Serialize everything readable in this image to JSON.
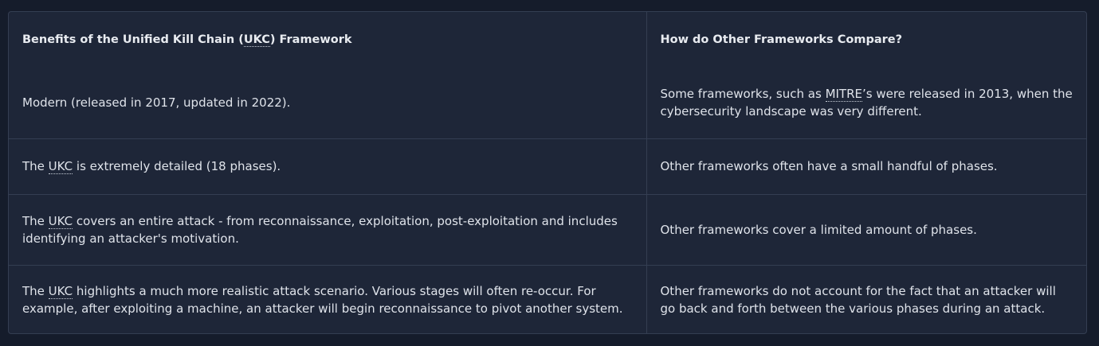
{
  "table": {
    "headers": [
      {
        "pre": "Benefits of the Unified Kill Chain (",
        "abbr": "UKC",
        "post": ") Framework"
      },
      {
        "pre": "How do Other Frameworks Compare?"
      }
    ],
    "rows": [
      [
        {
          "pre": "Modern (released in 2017, updated in 2022)."
        },
        {
          "pre": "Some frameworks, such as ",
          "abbr": "MITRE",
          "post": "’s were released in 2013, when the cybersecurity landscape was very different."
        }
      ],
      [
        {
          "pre": "The ",
          "abbr": "UKC",
          "post": " is extremely detailed (18 phases)."
        },
        {
          "pre": "Other frameworks often have a small handful of phases."
        }
      ],
      [
        {
          "pre": "The ",
          "abbr": "UKC",
          "post": " covers an entire attack - from reconnaissance, exploitation, post-exploitation and includes identifying an attacker's motivation."
        },
        {
          "pre": "Other frameworks cover a limited amount of phases."
        }
      ],
      [
        {
          "pre": "The ",
          "abbr": "UKC",
          "post": " highlights a much more realistic attack scenario. Various stages will often re-occur. For example, after exploiting a machine, an attacker will begin reconnaissance to pivot another system."
        },
        {
          "pre": "Other frameworks do not account for the fact that an attacker will go back and forth between the various phases during an attack."
        }
      ]
    ]
  }
}
